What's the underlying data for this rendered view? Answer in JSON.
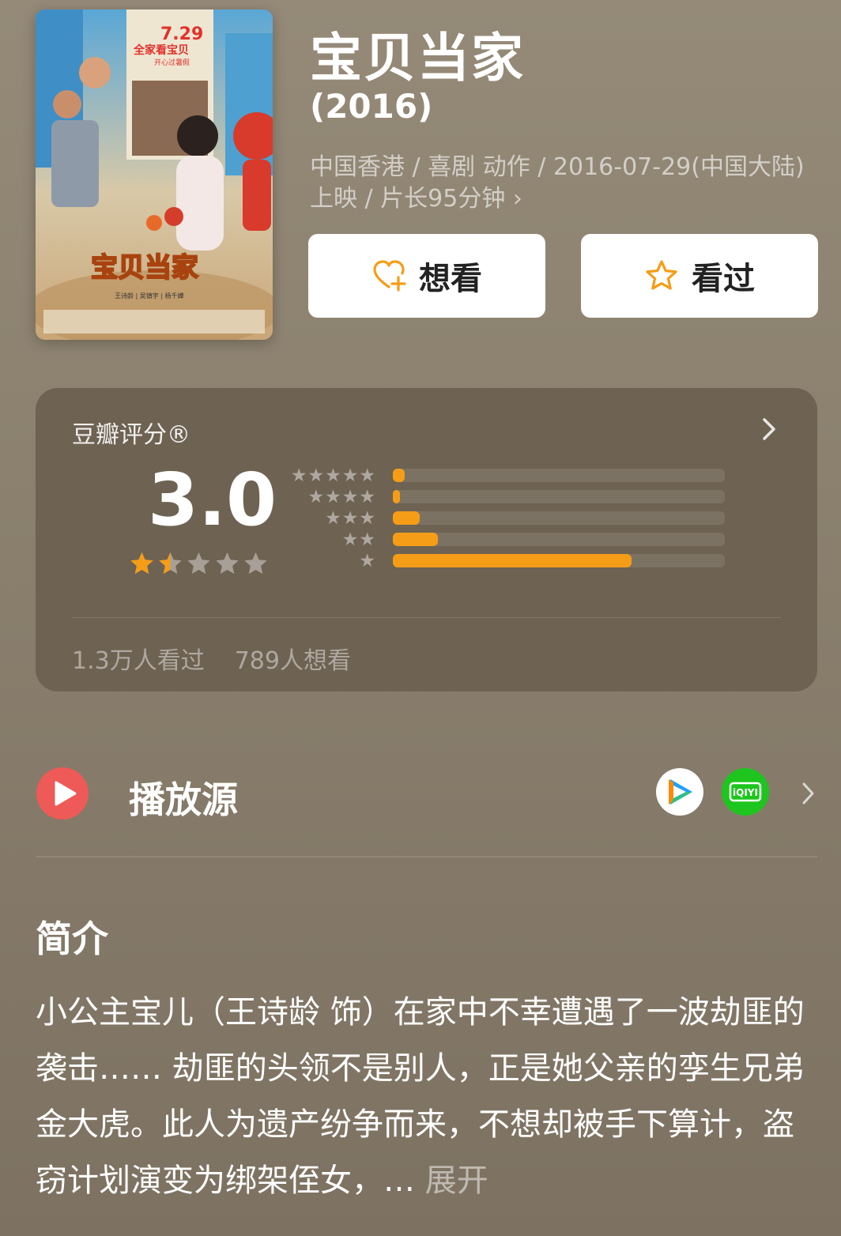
{
  "movie": {
    "title": "宝贝当家",
    "year": "(2016)",
    "meta": "中国香港 / 喜剧 动作 / 2016-07-29(中国大陆)上映 / 片长95分钟 ›"
  },
  "poster": {
    "date_text": "7.29",
    "tagline": "全家看宝贝",
    "subtag": "开心过暑假",
    "logo_text": "宝贝当家",
    "credits": "王诗龄 | 吴镇宇 | 杨千嬅"
  },
  "actions": {
    "want_label": "想看",
    "seen_label": "看过"
  },
  "rating": {
    "label": "豆瓣评分®",
    "score": "3.0",
    "stars_filled": 1.5,
    "distribution": [
      {
        "stars": 5,
        "fraction": 0.035
      },
      {
        "stars": 4,
        "fraction": 0.022
      },
      {
        "stars": 3,
        "fraction": 0.08
      },
      {
        "stars": 2,
        "fraction": 0.135
      },
      {
        "stars": 1,
        "fraction": 0.72
      }
    ],
    "watched_count": "1.3万人看过",
    "want_count": "789人想看"
  },
  "source": {
    "label": "播放源",
    "providers": [
      "tencent-video-icon",
      "iqiyi-icon"
    ],
    "iqiyi_text": "iQIYI"
  },
  "intro": {
    "title": "简介",
    "text": "小公主宝儿（王诗龄 饰）在家中不幸遭遇了一波劫匪的袭击…… 劫匪的头领不是别人，正是她父亲的孪生兄弟金大虎。此人为遗产纷争而来，不想却被手下算计，盗窃计划演变为绑架侄女，…",
    "expand": "展开"
  },
  "colors": {
    "accent": "#f59d17",
    "card_bg": "#6e6252",
    "play_red": "#ee5a57",
    "iqiyi_green": "#1ec51e"
  }
}
